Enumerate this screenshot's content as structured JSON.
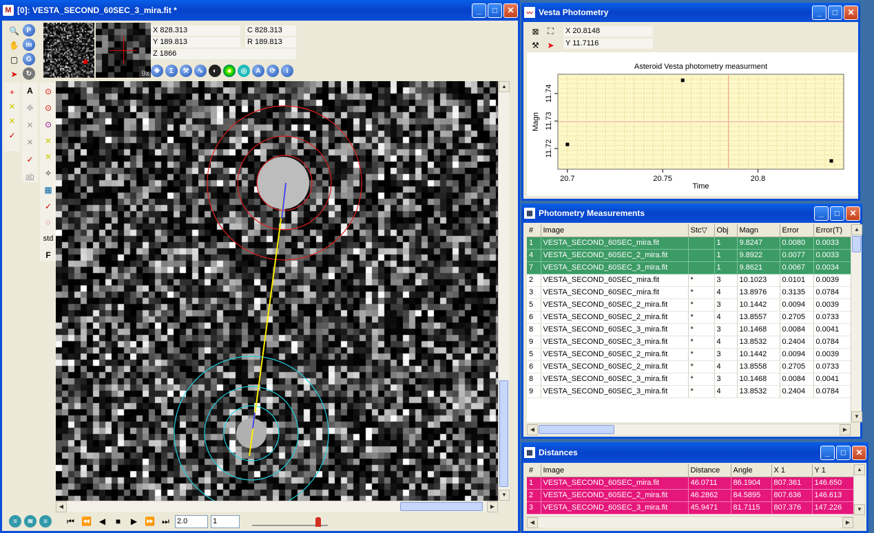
{
  "main_window": {
    "title": "[0]: VESTA_SECOND_60SEC_3_mira.fit *",
    "icon": "M",
    "coords": {
      "x": "X 828.313",
      "c": "C 828.313",
      "y": "Y 189.813",
      "r": "R 189.813",
      "z": "Z 1866"
    },
    "zoom_label": "9x",
    "bottom": {
      "step_value": "2.0",
      "frame_value": "1"
    },
    "left_tools_b": [
      "std",
      "F"
    ],
    "tool_ab": "ab"
  },
  "vesta_window": {
    "title": "Vesta Photometry",
    "x_readout": "X 20.8148",
    "y_readout": "Y 11.7116"
  },
  "chart_data": {
    "type": "scatter",
    "title": "Asteroid Vesta photometry measurment",
    "xlabel": "Time",
    "ylabel": "Magn",
    "xlim": [
      20.695,
      20.845
    ],
    "ylim": [
      11.7125,
      11.747
    ],
    "y_inverted": true,
    "x_ticks": [
      "20.7",
      "20.75",
      "20.8"
    ],
    "y_ticks": [
      "11.74",
      "11.73",
      "11.72"
    ],
    "grid": true,
    "points": [
      {
        "x": 20.7,
        "y": 11.7215
      },
      {
        "x": 20.7605,
        "y": 11.7448
      },
      {
        "x": 20.8385,
        "y": 11.7155
      }
    ]
  },
  "photometry_window": {
    "title": "Photometry Measurements",
    "columns": [
      "#",
      "Image",
      "Stc▽",
      "Obj",
      "Magn",
      "Error",
      "Error(T)"
    ],
    "rows": [
      {
        "n": "1",
        "image": "VESTA_SECOND_60SEC_mira.fit",
        "stc": "",
        "obj": "1",
        "magn": "9.8247",
        "err": "0.0080",
        "errt": "0.0033",
        "sel": true
      },
      {
        "n": "4",
        "image": "VESTA_SECOND_60SEC_2_mira.fit",
        "stc": "",
        "obj": "1",
        "magn": "9.8922",
        "err": "0.0077",
        "errt": "0.0033",
        "sel": true
      },
      {
        "n": "7",
        "image": "VESTA_SECOND_60SEC_3_mira.fit",
        "stc": "",
        "obj": "1",
        "magn": "9.8621",
        "err": "0.0067",
        "errt": "0.0034",
        "sel": true
      },
      {
        "n": "2",
        "image": "VESTA_SECOND_60SEC_mira.fit",
        "stc": "*",
        "obj": "3",
        "magn": "10.1023",
        "err": "0.0101",
        "errt": "0.0039",
        "sel": false
      },
      {
        "n": "3",
        "image": "VESTA_SECOND_60SEC_mira.fit",
        "stc": "*",
        "obj": "4",
        "magn": "13.8976",
        "err": "0.3135",
        "errt": "0.0784",
        "sel": false
      },
      {
        "n": "5",
        "image": "VESTA_SECOND_60SEC_2_mira.fit",
        "stc": "*",
        "obj": "3",
        "magn": "10.1442",
        "err": "0.0094",
        "errt": "0.0039",
        "sel": false
      },
      {
        "n": "6",
        "image": "VESTA_SECOND_60SEC_2_mira.fit",
        "stc": "*",
        "obj": "4",
        "magn": "13.8557",
        "err": "0.2705",
        "errt": "0.0733",
        "sel": false
      },
      {
        "n": "8",
        "image": "VESTA_SECOND_60SEC_3_mira.fit",
        "stc": "*",
        "obj": "3",
        "magn": "10.1468",
        "err": "0.0084",
        "errt": "0.0041",
        "sel": false
      },
      {
        "n": "9",
        "image": "VESTA_SECOND_60SEC_3_mira.fit",
        "stc": "*",
        "obj": "4",
        "magn": "13.8532",
        "err": "0.2404",
        "errt": "0.0784",
        "sel": false
      },
      {
        "n": "5",
        "image": "VESTA_SECOND_60SEC_2_mira.fit",
        "stc": "*",
        "obj": "3",
        "magn": "10.1442",
        "err": "0.0094",
        "errt": "0.0039",
        "sel": false
      },
      {
        "n": "6",
        "image": "VESTA_SECOND_60SEC_2_mira.fit",
        "stc": "*",
        "obj": "4",
        "magn": "13.8558",
        "err": "0.2705",
        "errt": "0.0733",
        "sel": false
      },
      {
        "n": "8",
        "image": "VESTA_SECOND_60SEC_3_mira.fit",
        "stc": "*",
        "obj": "3",
        "magn": "10.1468",
        "err": "0.0084",
        "errt": "0.0041",
        "sel": false
      },
      {
        "n": "9",
        "image": "VESTA_SECOND_60SEC_3_mira.fit",
        "stc": "*",
        "obj": "4",
        "magn": "13.8532",
        "err": "0.2404",
        "errt": "0.0784",
        "sel": false
      }
    ]
  },
  "distances_window": {
    "title": "Distances",
    "columns": [
      "#",
      "Image",
      "Distance",
      "Angle",
      "X 1",
      "Y 1"
    ],
    "rows": [
      {
        "n": "1",
        "image": "VESTA_SECOND_60SEC_mira.fit",
        "dist": "46.0711",
        "angle": "86.1904",
        "x1": "807.361",
        "y1": "146.650"
      },
      {
        "n": "2",
        "image": "VESTA_SECOND_60SEC_2_mira.fit",
        "dist": "46.2862",
        "angle": "84.5895",
        "x1": "807.636",
        "y1": "146.613"
      },
      {
        "n": "3",
        "image": "VESTA_SECOND_60SEC_3_mira.fit",
        "dist": "45.9471",
        "angle": "81.7115",
        "x1": "807.376",
        "y1": "147.226"
      }
    ]
  },
  "colors": {
    "selected_green": "#3d9b66",
    "selected_pink": "#e5177a",
    "aperture_red": "#e02020",
    "aperture_cyan": "#20d0e0",
    "title_blue": "#0a4fd8"
  }
}
